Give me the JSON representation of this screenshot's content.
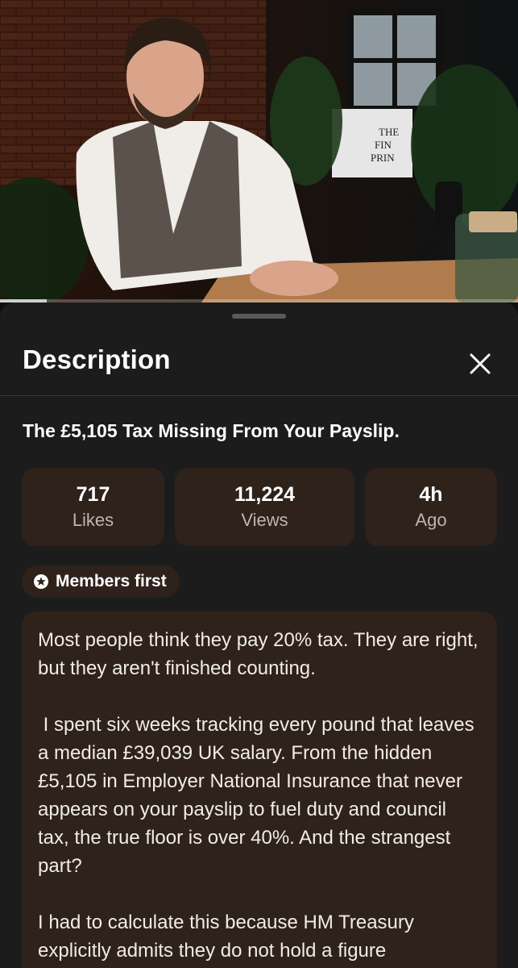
{
  "video": {
    "progress_fraction": 0.09,
    "sign_lines": [
      "THE",
      "FIN",
      "PRIN"
    ]
  },
  "description_sheet": {
    "title": "Description",
    "close_icon": "close-icon",
    "video_title": "The £5,105 Tax Missing From Your Payslip.",
    "stats": [
      {
        "value": "717",
        "label": "Likes"
      },
      {
        "value": "11,224",
        "label": "Views"
      },
      {
        "value": "4h",
        "label": "Ago"
      }
    ],
    "badge": {
      "icon": "star-circle-icon",
      "label": "Members first"
    },
    "paragraphs": [
      "Most people think they pay 20% tax. They are right, but they aren't finished counting.",
      " I spent six weeks tracking every pound that leaves a median £39,039 UK salary. From the hidden £5,105 in Employer National Insurance that never appears on your payslip to fuel duty and council tax, the true floor is over 40%. And the strangest part?",
      "I had to calculate this because HM Treasury explicitly admits they do not hold a figure"
    ]
  },
  "colors": {
    "sheet_bg": "#1c1c1c",
    "card_bg": "#2e221b",
    "text_primary": "#ffffff",
    "text_secondary": "#bdb5b0"
  }
}
